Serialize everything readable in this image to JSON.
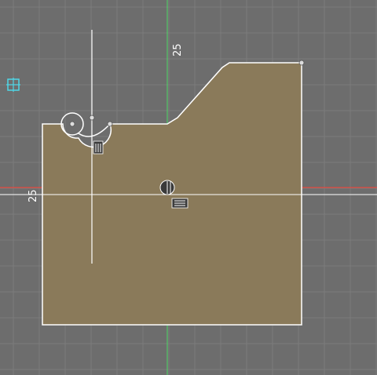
{
  "viewport": {
    "background": "#6d6d6d",
    "grid_color": "#7c7c7c",
    "x_axis_color": "#ff3b30",
    "y_axis_color": "#4cd964",
    "profile_fill": "#8a7a5a",
    "profile_stroke": "#ffffff",
    "construction_line_color": "#ffffff",
    "origin_icon_color": "#4fd6e6"
  },
  "dimensions": {
    "top_label": "25",
    "left_label": "25"
  },
  "icons": {
    "origin_marker": "origin-crosshair-icon",
    "center_marker": "sketch-center-icon",
    "constraint_fix": "fix-constraint-icon",
    "constraint_arc": "tangent-constraint-icon"
  }
}
